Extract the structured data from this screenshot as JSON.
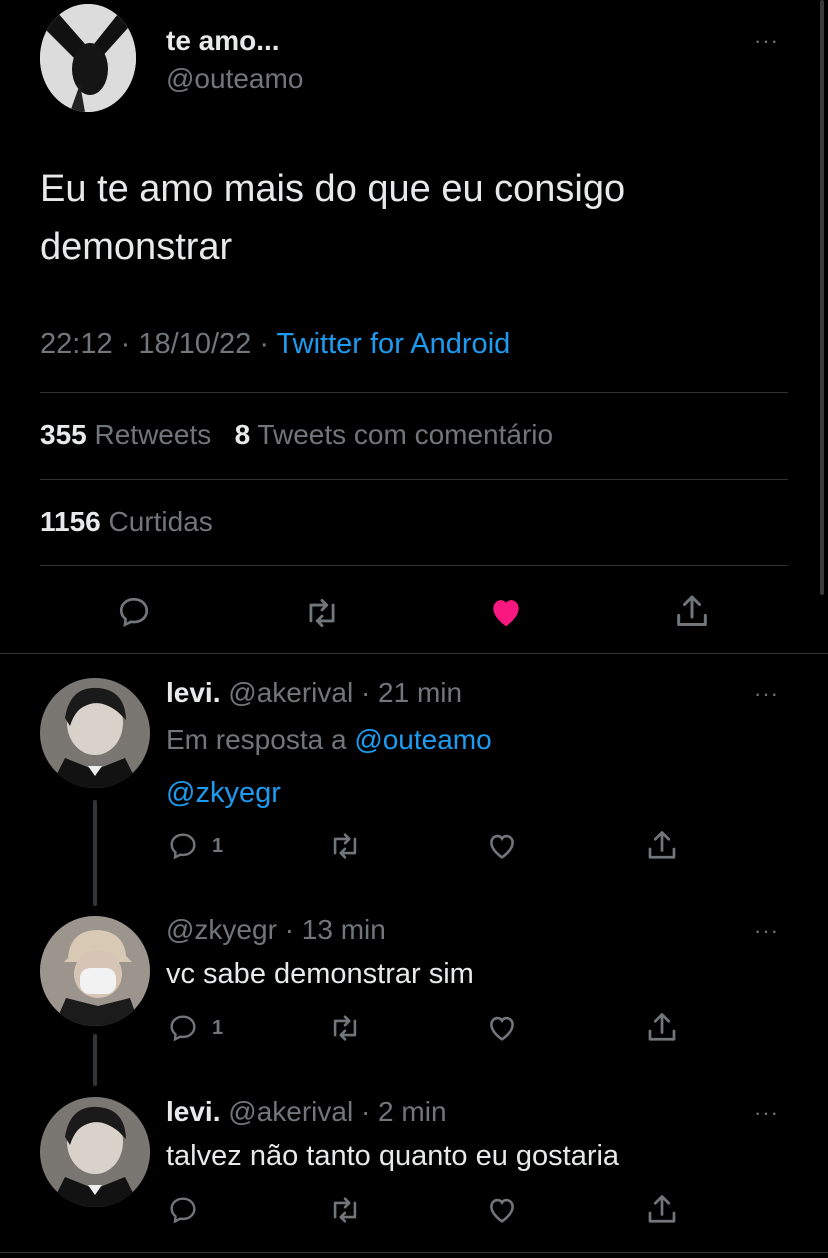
{
  "main_tweet": {
    "display_name": "te amo...",
    "handle": "@outeamo",
    "text_line1": "Eu te amo mais do que eu consigo",
    "text_line2": "demonstrar",
    "time": "22:12",
    "sep1": "·",
    "date": "18/10/22",
    "sep2": "·",
    "source": "Twitter for Android",
    "retweets_count": "355",
    "retweets_label": "Retweets",
    "quotes_count": "8",
    "quotes_label": "Tweets com comentário",
    "likes_count": "1156",
    "likes_label": "Curtidas",
    "liked": true
  },
  "replies": [
    {
      "display_name": "levi.",
      "handle": "@akerival",
      "time_ago": "· 21 min",
      "reply_to_prefix": "Em resposta a",
      "reply_to_handle": "@outeamo",
      "text": "@zkyegr",
      "reply_count": "1"
    },
    {
      "handle": "@zkyegr",
      "time_ago": "· 13 min",
      "text": "vc sabe demonstrar sim",
      "reply_count": "1"
    },
    {
      "display_name": "levi.",
      "handle": "@akerival",
      "time_ago": "· 2 min",
      "text": "talvez não tanto quanto eu gostaria",
      "reply_count": ""
    }
  ],
  "more_glyph": "···",
  "colors": {
    "background": "#000000",
    "text": "#e7e9ea",
    "secondary": "#71767b",
    "link": "#1d9bf0",
    "like": "#f91880",
    "divider": "#2f3336"
  }
}
